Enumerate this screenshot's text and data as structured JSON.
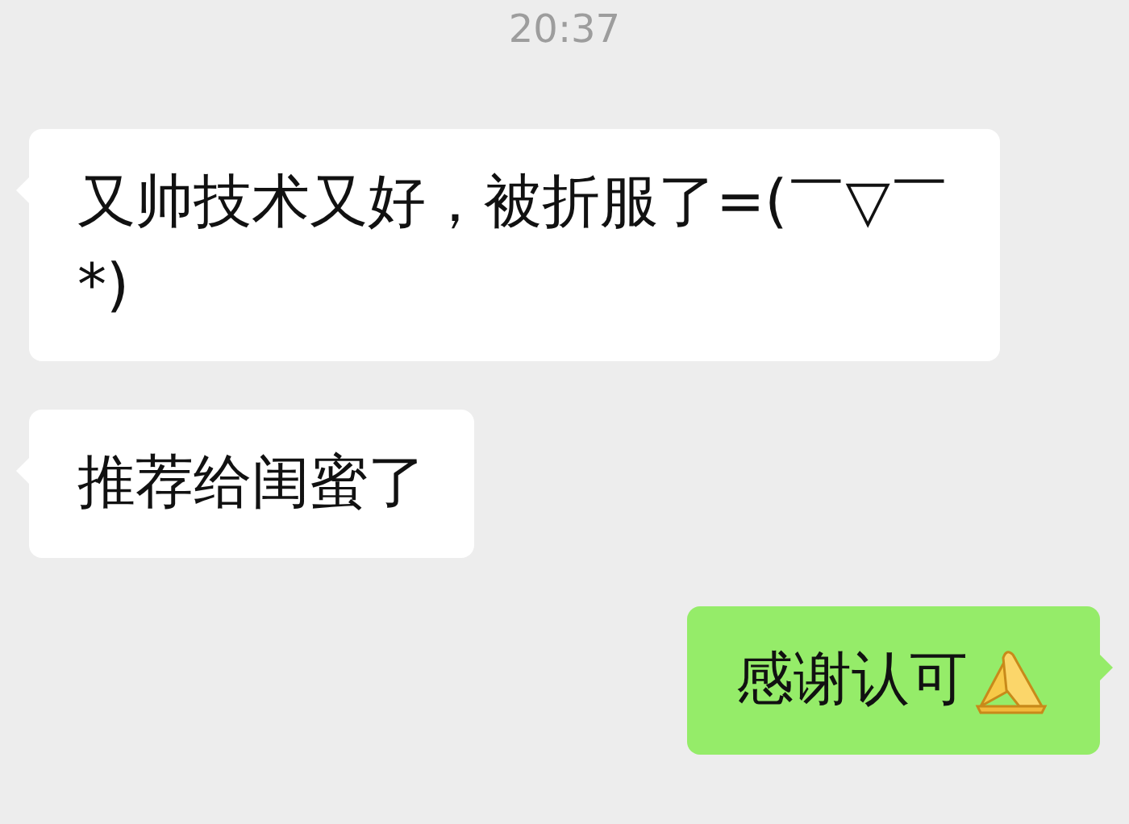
{
  "timestamp": "20:37",
  "messages": [
    {
      "kind": "incoming",
      "text": "又帅技术又好，被折服了=(￣▽￣*)"
    },
    {
      "kind": "incoming",
      "text": "推荐给闺蜜了"
    },
    {
      "kind": "outgoing",
      "text": "感谢认可",
      "emoji": true
    }
  ]
}
